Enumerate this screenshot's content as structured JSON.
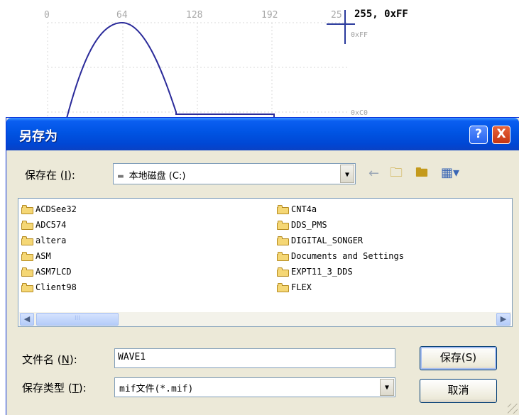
{
  "waveform": {
    "x_ticks": [
      "0",
      "64",
      "128",
      "192",
      "25"
    ],
    "cursor_readout": "255, 0xFF",
    "hex_labels": [
      "0xFF",
      "0xC0"
    ]
  },
  "dialog": {
    "title": "另存为",
    "help_label": "?",
    "close_label": "X",
    "save_in_label": "保存在 (",
    "save_in_key": "I",
    "save_in_label_end": "):",
    "save_in_value": "本地磁盘 (C:)",
    "files_left": [
      "ACDSee32",
      "ADC574",
      "altera",
      "ASM",
      "ASM7LCD",
      "Client98"
    ],
    "files_right": [
      "CNT4a",
      "DDS_PMS",
      "DIGITAL_SONGER",
      "Documents and Settings",
      "EXPT11_3_DDS",
      "FLEX"
    ],
    "filename_label": "文件名 (",
    "filename_key": "N",
    "filename_label_end": "):",
    "filename_value": "WAVE1",
    "filetype_label": "保存类型 (",
    "filetype_key": "T",
    "filetype_label_end": "):",
    "filetype_value": "mif文件(*.mif)",
    "save_button": "保存(S)",
    "cancel_button": "取消",
    "scroll_thumb_grip": "III"
  }
}
